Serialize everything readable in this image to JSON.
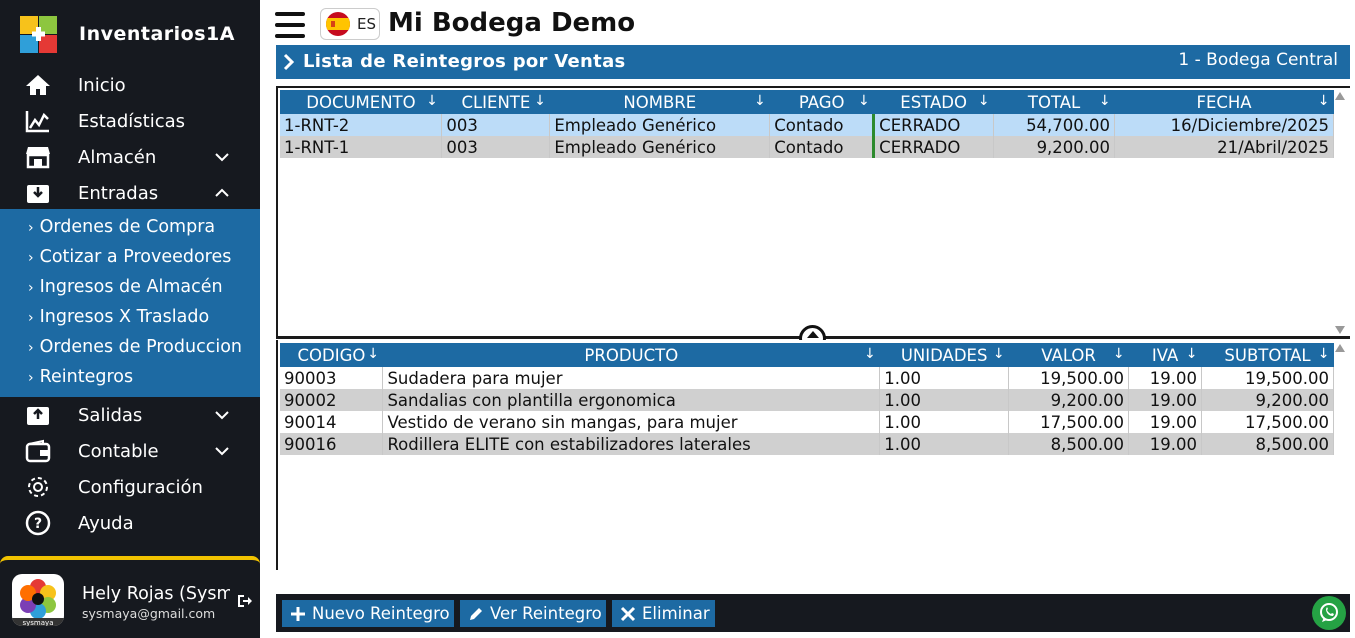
{
  "sidebar": {
    "brand": "Inventarios1A",
    "items": [
      {
        "label": "Inicio",
        "icon": "home-icon"
      },
      {
        "label": "Estadísticas",
        "icon": "chart-icon"
      },
      {
        "label": "Almacén",
        "icon": "store-icon"
      },
      {
        "label": "Entradas",
        "icon": "inbox-in-icon"
      },
      {
        "label": "Salidas",
        "icon": "inbox-out-icon"
      },
      {
        "label": "Contable",
        "icon": "wallet-icon"
      },
      {
        "label": "Configuración",
        "icon": "gear-icon"
      },
      {
        "label": "Ayuda",
        "icon": "help-icon"
      }
    ],
    "submenu": [
      "Ordenes de Compra",
      "Cotizar a Proveedores",
      "Ingresos de Almacén",
      "Ingresos X Traslado",
      "Ordenes de Produccion",
      "Reintegros"
    ],
    "user": {
      "name": "Hely Rojas (Sysmaya)",
      "email": "sysmaya@gmail.com",
      "avatar_text": "sysmaya"
    }
  },
  "header": {
    "lang": "ES",
    "title": "Mi Bodega Demo"
  },
  "title_bar": {
    "title": "Lista de Reintegros por Ventas",
    "warehouse": "1 - Bodega Central"
  },
  "top_grid": {
    "columns": [
      "DOCUMENTO",
      "CLIENTE",
      "NOMBRE",
      "PAGO",
      "ESTADO",
      "TOTAL",
      "FECHA"
    ],
    "rows": [
      [
        "1-RNT-2",
        "003",
        "Empleado Genérico",
        "Contado",
        "CERRADO",
        "54,700.00",
        "16/Diciembre/2025"
      ],
      [
        "1-RNT-1",
        "003",
        "Empleado Genérico",
        "Contado",
        "CERRADO",
        "9,200.00",
        "21/Abril/2025"
      ]
    ]
  },
  "bottom_grid": {
    "columns": [
      "CODIGO",
      "PRODUCTO",
      "UNIDADES",
      "VALOR",
      "IVA",
      "SUBTOTAL"
    ],
    "rows": [
      [
        "90003",
        "Sudadera para mujer",
        "1.00",
        "19,500.00",
        "19.00",
        "19,500.00"
      ],
      [
        "90002",
        "Sandalias con plantilla ergonomica",
        "1.00",
        "9,200.00",
        "19.00",
        "9,200.00"
      ],
      [
        "90014",
        "Vestido de verano sin mangas, para mujer",
        "1.00",
        "17,500.00",
        "19.00",
        "17,500.00"
      ],
      [
        "90016",
        "Rodillera ELITE con estabilizadores laterales",
        "1.00",
        "8,500.00",
        "19.00",
        "8,500.00"
      ]
    ]
  },
  "footer": {
    "new": "Nuevo Reintegro",
    "view": "Ver Reintegro",
    "delete": "Eliminar"
  },
  "colors": {
    "accent": "#1d6aa3",
    "sidebar": "#16191f",
    "selected_row": "#bcdcf8",
    "alt_row": "#d0d0d0",
    "whatsapp": "#25a244"
  }
}
